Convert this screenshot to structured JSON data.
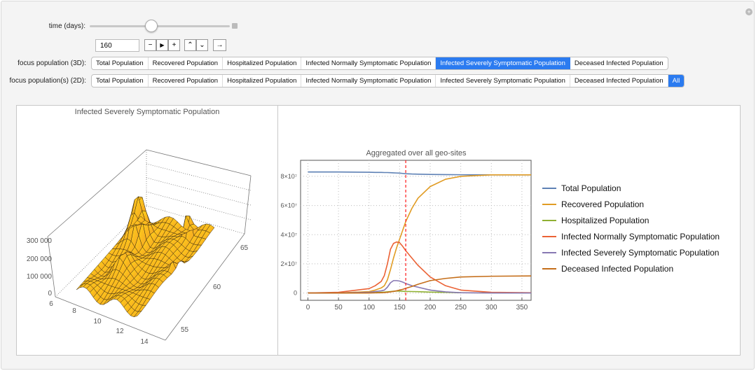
{
  "controls": {
    "time_label": "time (days):",
    "time_value": "160",
    "time_fraction": 0.44,
    "buttons": {
      "decrement": "−",
      "play": "▶",
      "increment": "+",
      "faster": "⌃",
      "slower": "⌄",
      "direction": "→"
    },
    "focus3d_label": "focus population (3D):",
    "focus2d_label": "focus population(s) (2D):",
    "options3d": [
      "Total Population",
      "Recovered Population",
      "Hospitalized Population",
      "Infected Normally Symptomatic Population",
      "Infected Severely Symptomatic Population",
      "Deceased Infected Population"
    ],
    "selected3d": "Infected Severely Symptomatic Population",
    "options2d": [
      "Total Population",
      "Recovered Population",
      "Hospitalized Population",
      "Infected Normally Symptomatic Population",
      "Infected Severely Symptomatic Population",
      "Deceased Infected Population",
      "All"
    ],
    "selected2d": "All"
  },
  "plot3d": {
    "title": "Infected Severely Symptomatic Population",
    "z_ticks": [
      "0",
      "100 000",
      "200 000",
      "300 000"
    ],
    "x_ticks": [
      "6",
      "8",
      "10",
      "12",
      "14"
    ],
    "y_ticks": [
      "55",
      "60",
      "65"
    ],
    "surface_color": "#f5a623"
  },
  "chart_data": {
    "type": "line",
    "title": "Aggregated over all geo-sites",
    "xlim": [
      -12,
      365
    ],
    "ylim": [
      -5000000,
      91000000
    ],
    "x_ticks": [
      0,
      50,
      100,
      150,
      200,
      250,
      300,
      350
    ],
    "y_ticks": [
      {
        "v": 0,
        "label": "0"
      },
      {
        "v": 20000000,
        "label": "2×10⁷"
      },
      {
        "v": 40000000,
        "label": "4×10⁷"
      },
      {
        "v": 60000000,
        "label": "6×10⁷"
      },
      {
        "v": 80000000,
        "label": "8×10⁷"
      }
    ],
    "grid": true,
    "marker_x": 160,
    "marker_color": "#ff2a2a",
    "legend_position": "right",
    "x": [
      0,
      50,
      100,
      110,
      120,
      125,
      130,
      135,
      140,
      145,
      150,
      155,
      160,
      170,
      180,
      200,
      225,
      250,
      300,
      365
    ],
    "series": [
      {
        "name": "Total Population",
        "color": "#5e81b5",
        "values": [
          83000000.0,
          83000000.0,
          82800000.0,
          82700000.0,
          82700000.0,
          82600000.0,
          82600000.0,
          82500000.0,
          82400000.0,
          82300000.0,
          82200000.0,
          82000000.0,
          81800000.0,
          81600000.0,
          81500000.0,
          81300000.0,
          81200000.0,
          81100000.0,
          81000000.0,
          81000000.0
        ]
      },
      {
        "name": "Recovered Population",
        "color": "#e19c24",
        "values": [
          0,
          0,
          1000000.0,
          2000000.0,
          3500000.0,
          5000000.0,
          9000000.0,
          16000000.0,
          24000000.0,
          31000000.0,
          37000000.0,
          43000000.0,
          49000000.0,
          58000000.0,
          65000000.0,
          73000000.0,
          78000000.0,
          80000000.0,
          81000000.0,
          81000000.0
        ]
      },
      {
        "name": "Hospitalized Population",
        "color": "#8fb032",
        "values": [
          0,
          0,
          200000.0,
          300000.0,
          500000.0,
          600000.0,
          800000.0,
          1000000.0,
          1200000.0,
          1300000.0,
          1300000.0,
          1200000.0,
          1100000.0,
          1000000.0,
          900000.0,
          600000.0,
          400000.0,
          200000.0,
          100000.0,
          100000.0
        ]
      },
      {
        "name": "Infected Normally Symptomatic Population",
        "color": "#eb6235",
        "values": [
          0,
          500000.0,
          3000000.0,
          5000000.0,
          8000000.0,
          12000000.0,
          20000000.0,
          30000000.0,
          34000000.0,
          35000000.0,
          34500000.0,
          32000000.0,
          29000000.0,
          24000000.0,
          19000000.0,
          11000000.0,
          5000000.0,
          2000000.0,
          500000.0,
          200000.0
        ]
      },
      {
        "name": "Infected Severely Symptomatic Population",
        "color": "#8778b3",
        "values": [
          0,
          0,
          500000.0,
          1000000.0,
          1500000.0,
          2000000.0,
          4000000.0,
          7000000.0,
          8500000.0,
          8500000.0,
          8200000.0,
          7500000.0,
          6500000.0,
          5000000.0,
          4000000.0,
          2000000.0,
          800000.0,
          200000.0,
          0,
          0
        ]
      },
      {
        "name": "Deceased Infected Population",
        "color": "#c56e1a",
        "values": [
          0,
          0,
          0,
          100000.0,
          200000.0,
          300000.0,
          500000.0,
          800000.0,
          1100000.0,
          1500000.0,
          2000000.0,
          2500000.0,
          3200000.0,
          4500000.0,
          6000000.0,
          8500000.0,
          10000000.0,
          11000000.0,
          11500000.0,
          11700000.0
        ]
      }
    ]
  }
}
